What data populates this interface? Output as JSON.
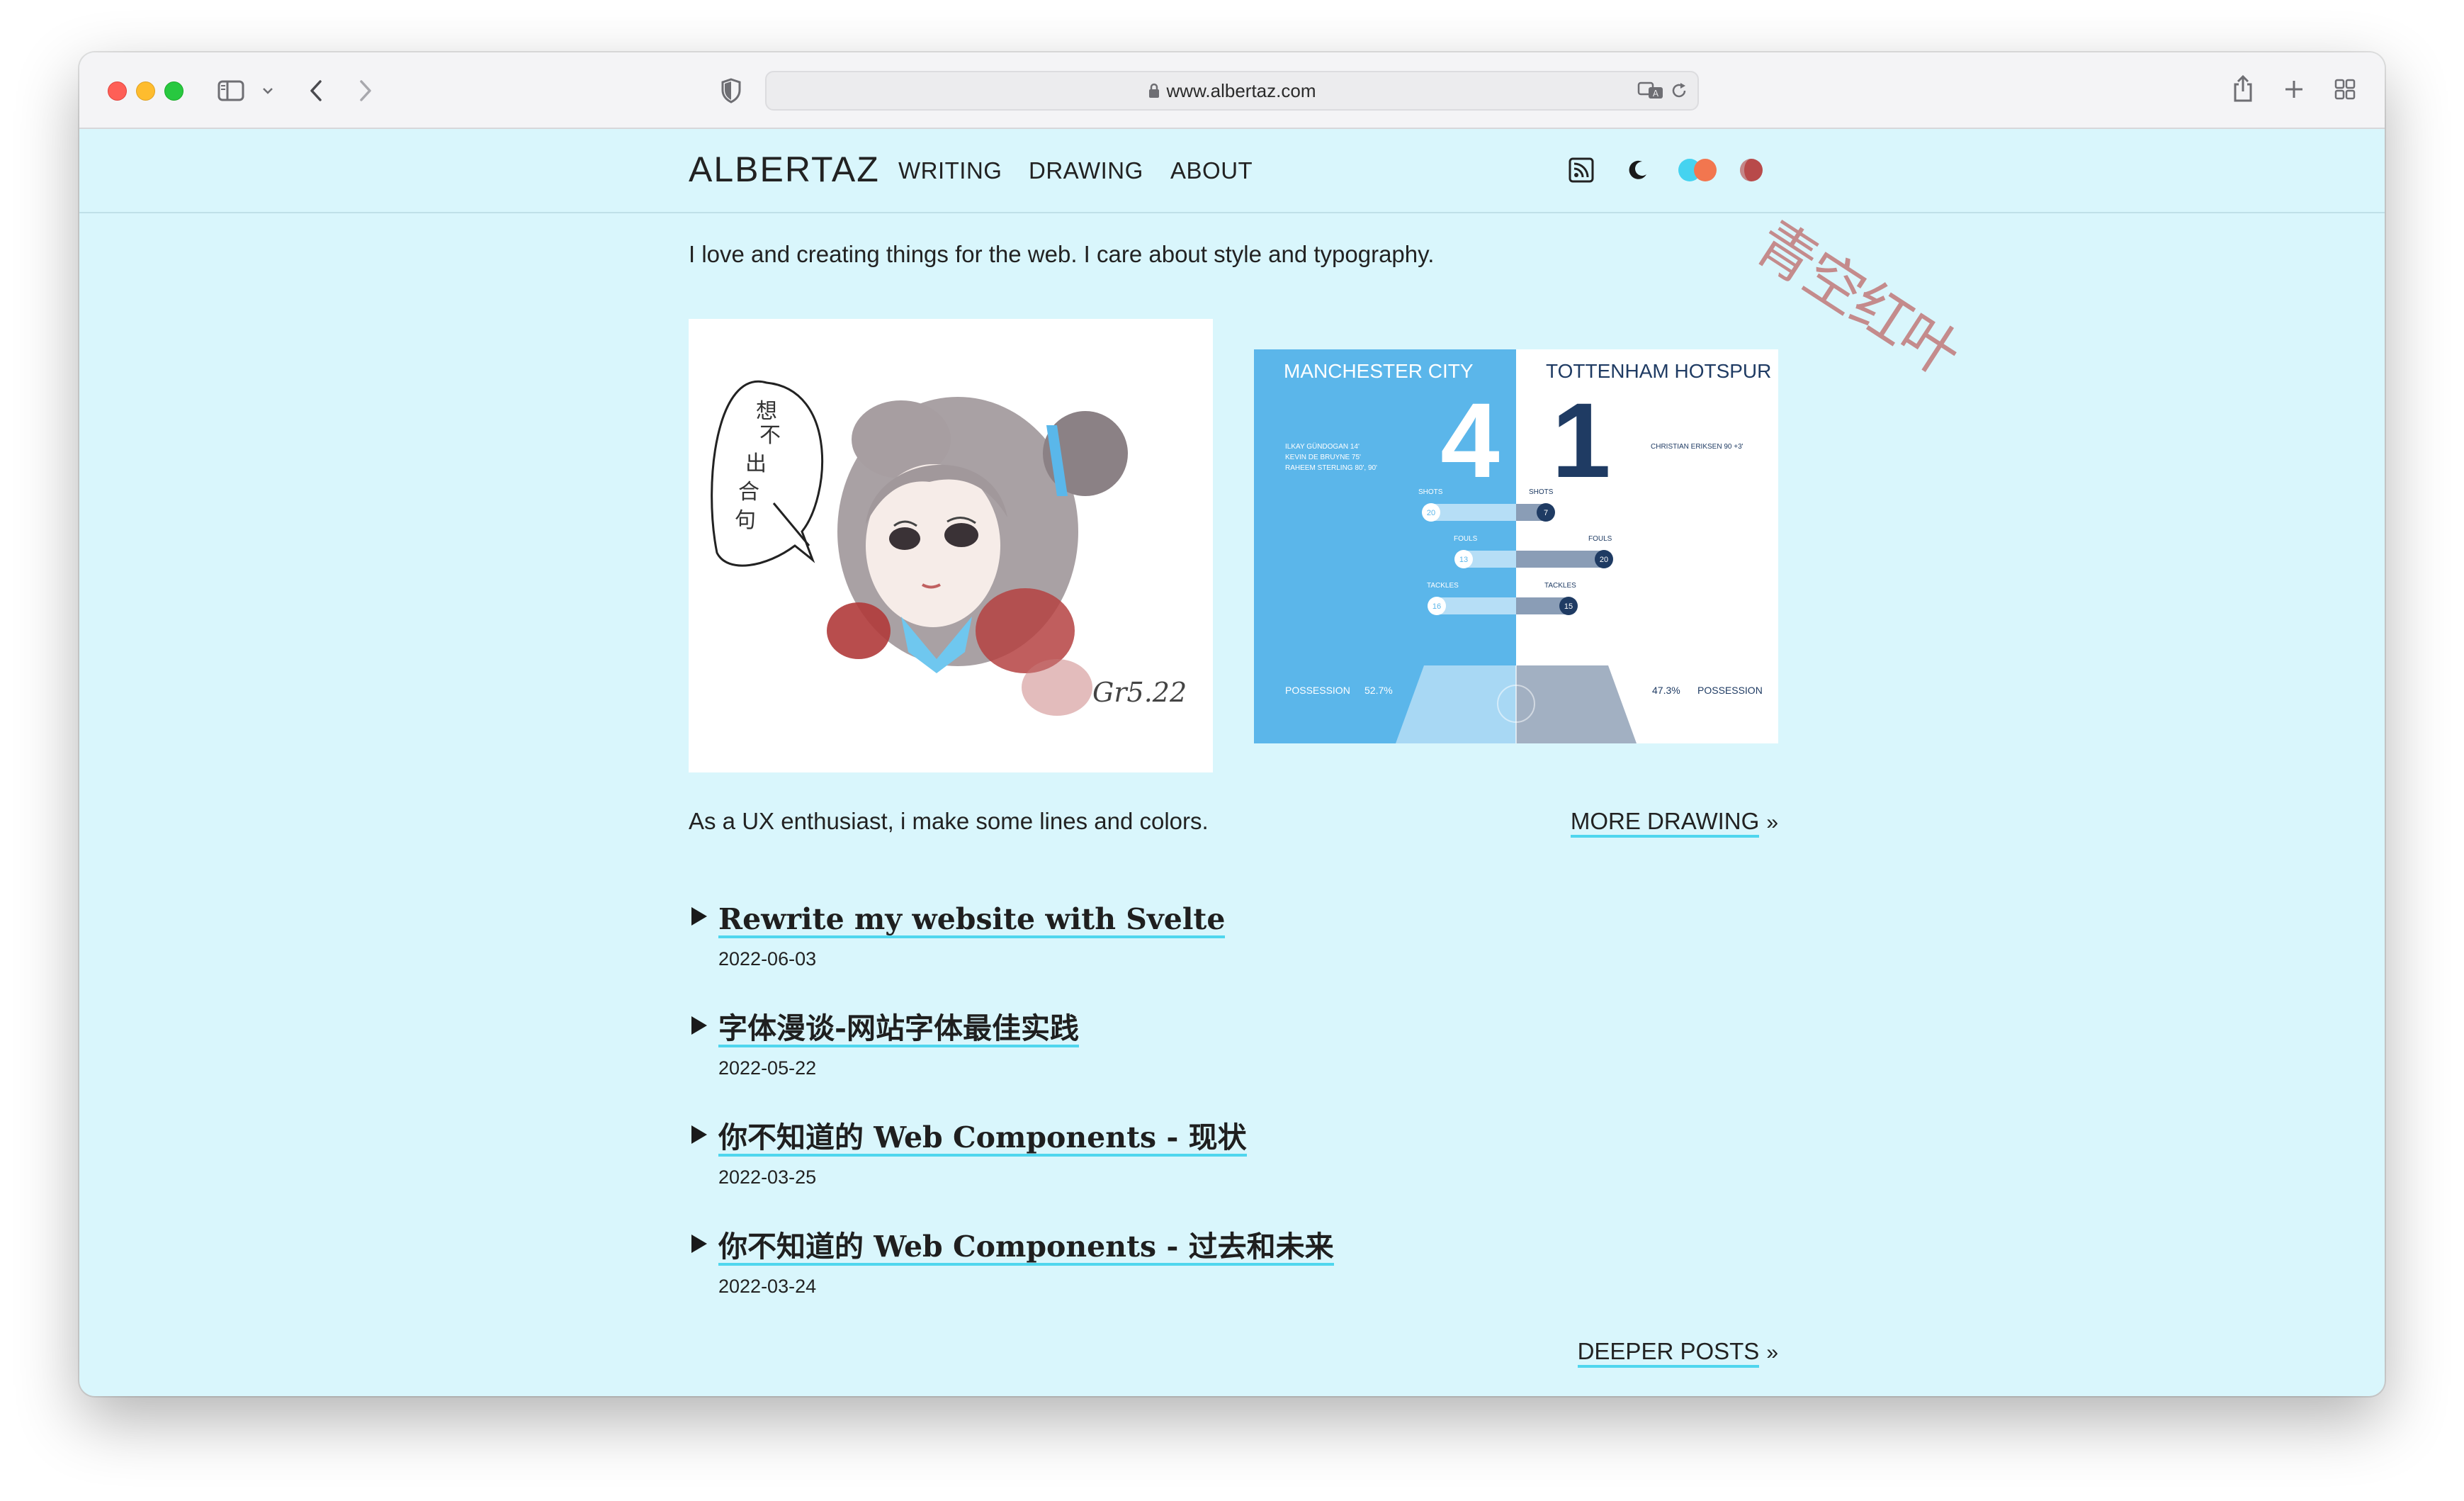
{
  "browser": {
    "url": "www.albertaz.com"
  },
  "site": {
    "logo": "ALBERTAZ",
    "nav": [
      "WRITING",
      "DRAWING",
      "ABOUT"
    ],
    "stamp": "青空红叶",
    "theme_colors": [
      "#45d3f0",
      "#f2764f",
      "#b84a4a"
    ]
  },
  "intro": "I love and creating things for the web. I care about style and typography.",
  "drawing_left": {
    "handwritten_note": "想不出合句",
    "signature": "Gr5.22"
  },
  "drawing_right": {
    "home_team": "MANCHESTER CITY",
    "away_team": "TOTTENHAM HOTSPUR",
    "home_score": "4",
    "away_score": "1",
    "home_scorers": [
      "ILKAY GÜNDOGAN 14'",
      "KEVIN DE BRUYNE 75'",
      "RAHEEM STERLING 80', 90'"
    ],
    "away_scorers": [
      "CHRISTIAN ERIKSEN 90 +3'"
    ],
    "stats": [
      {
        "label": "SHOTS",
        "home": "20",
        "away": "7"
      },
      {
        "label": "FOULS",
        "home": "13",
        "away": "20"
      },
      {
        "label": "TACKLES",
        "home": "16",
        "away": "15"
      }
    ],
    "possession_label": "POSSESSION",
    "home_possession": "52.7%",
    "away_possession": "47.3%",
    "colors": {
      "home": "#5bb6ea",
      "away": "#1f3b63"
    }
  },
  "tagline": "As a UX enthusiast, i make some lines and colors.",
  "more_drawing": "MORE DRAWING",
  "posts": [
    {
      "title": "Rewrite my website with Svelte",
      "date": "2022-06-03"
    },
    {
      "title": "字体漫谈-网站字体最佳实践",
      "date": "2022-05-22"
    },
    {
      "title": "你不知道的 Web Components - 现状",
      "date": "2022-03-25"
    },
    {
      "title": "你不知道的 Web Components - 过去和未来",
      "date": "2022-03-24"
    }
  ],
  "deeper_posts": "DEEPER POSTS"
}
